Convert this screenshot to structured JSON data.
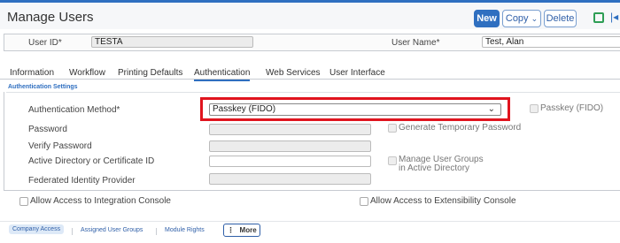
{
  "header": {
    "title": "Manage Users",
    "new_label": "New",
    "copy_label": "Copy",
    "delete_label": "Delete",
    "copy_chevron": "⌄",
    "first_record_glyph": "|◂"
  },
  "id_row": {
    "user_id_label": "User ID",
    "user_id_value": "TESTA",
    "user_name_label": "User Name",
    "user_name_value": "Test, Alan",
    "required_mark": "*"
  },
  "tabs": [
    {
      "label": "Information"
    },
    {
      "label": "Workflow"
    },
    {
      "label": "Printing Defaults"
    },
    {
      "label": "Authentication",
      "active": true
    },
    {
      "label": "Web Services"
    },
    {
      "label": "User Interface"
    }
  ],
  "auth": {
    "section_title": "Authentication Settings",
    "method_label": "Authentication Method",
    "method_value": "Passkey (FIDO)",
    "passkey_checkbox_label": "Passkey (FIDO)",
    "password_label": "Password",
    "password_value": "",
    "generate_temp_label": "Generate Temporary Password",
    "verify_password_label": "Verify Password",
    "verify_password_value": "",
    "ad_cert_label": "Active Directory or Certificate ID",
    "ad_cert_value": "",
    "manage_groups_label_1": "Manage User Groups",
    "manage_groups_label_2": "in Active Directory",
    "federated_label": "Federated Identity Provider",
    "federated_value": ""
  },
  "access": {
    "integration_label": "Allow Access to Integration Console",
    "extensibility_label": "Allow Access to Extensibility Console"
  },
  "footer": {
    "links": [
      "Company Access",
      "Assigned User Groups",
      "Module Rights"
    ],
    "more_label": "More",
    "more_glyph": "⋮"
  },
  "colors": {
    "accent": "#2f6fc0",
    "highlight_box": "#e0141e",
    "status_icon": "#2e9e55"
  }
}
